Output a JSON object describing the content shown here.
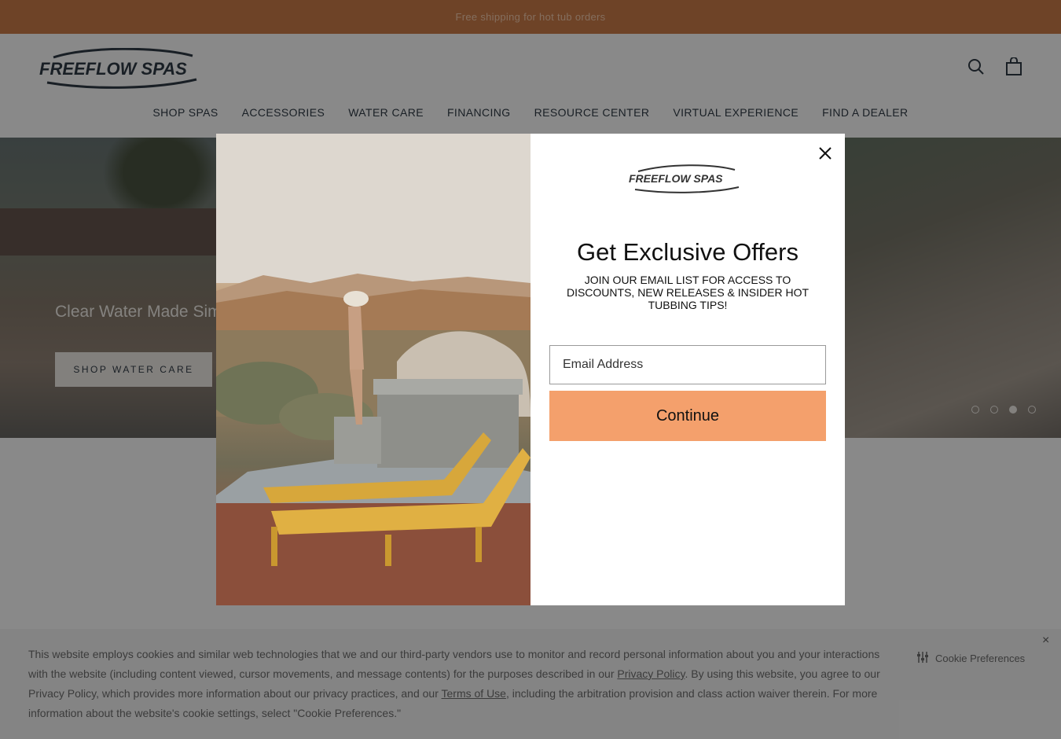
{
  "announcement": {
    "text": "Free shipping for hot tub orders"
  },
  "header": {
    "logo_text": "FREEFLOW SPAS",
    "nav": [
      "SHOP SPAS",
      "ACCESSORIES",
      "WATER CARE",
      "FINANCING",
      "RESOURCE CENTER",
      "VIRTUAL EXPERIENCE",
      "FIND A DEALER"
    ]
  },
  "hero": {
    "title": "Clear Water Made Sim",
    "button_label": "SHOP WATER CARE",
    "slides_total": 4,
    "active_slide": 3
  },
  "modal": {
    "logo_text": "FREEFLOW SPAS",
    "title": "Get Exclusive Offers",
    "subtitle": "JOIN OUR EMAIL LIST FOR ACCESS TO DISCOUNTS, NEW RELEASES & INSIDER HOT TUBBING TIPS!",
    "email_placeholder": "Email Address",
    "button_label": "Continue"
  },
  "cookie": {
    "text_1": "This website employs cookies and similar web technologies that we and our third-party vendors use to monitor and record personal information about you and your interactions with the website (including content viewed, cursor movements, and message contents) for the purposes described in our ",
    "privacy_link": "Privacy Policy",
    "text_2": ". By using this website, you agree to our Privacy Policy, which provides more information about our privacy practices, and our ",
    "terms_link": "Terms of Use",
    "text_3": ", including the arbitration provision and class action waiver therein. For more information about the website's cookie settings, select \"Cookie Preferences.\"",
    "preferences_label": "Cookie Preferences",
    "close_label": "×"
  },
  "colors": {
    "announcement_bg": "#c8723b",
    "button_accent": "#f4a06c",
    "nav_text": "#1e2a36"
  }
}
